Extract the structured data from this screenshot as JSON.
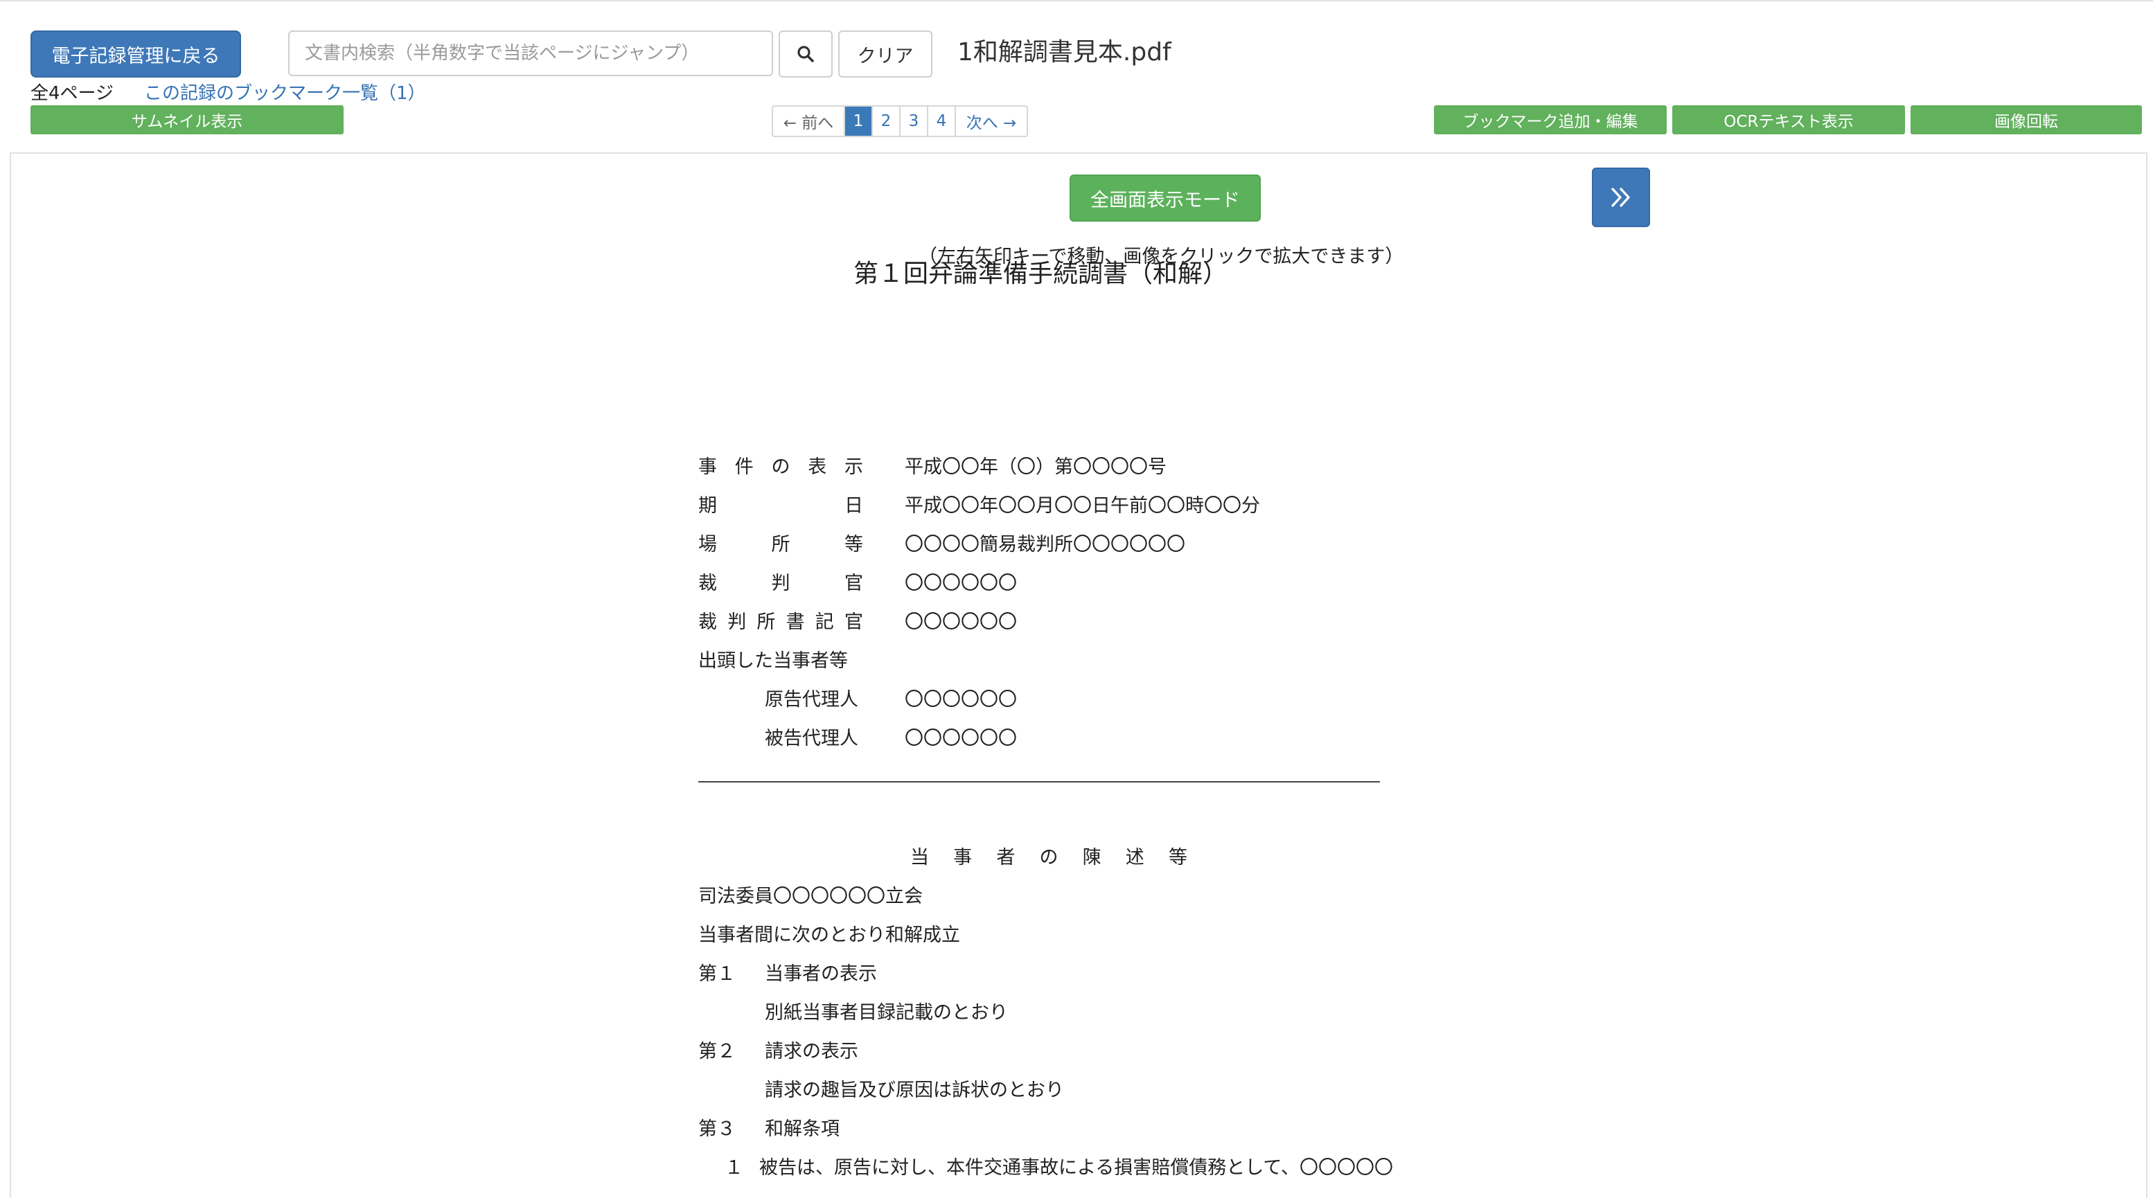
{
  "header": {
    "back_button": "電子記録管理に戻る",
    "search_placeholder": "文書内検索（半角数字で当該ページにジャンプ）",
    "clear_button": "クリア",
    "filename": "1和解調書見本.pdf",
    "page_count": "全4ページ",
    "bookmark_link": "この記録のブックマーク一覧（1）"
  },
  "toolbar": {
    "thumbnail_button": "サムネイル表示",
    "bookmark_edit_button": "ブックマーク追加・編集",
    "ocr_button": "OCRテキスト表示",
    "rotate_button": "画像回転"
  },
  "pagination": {
    "prev": "← 前へ",
    "pages": [
      "1",
      "2",
      "3",
      "4"
    ],
    "current": "1",
    "next": "次へ →"
  },
  "viewer": {
    "fullscreen_button": "全画面表示モード",
    "hint": "（左右矢印キーで移動、画像をクリックで拡大できます）"
  },
  "document": {
    "title": "第１回弁論準備手続調書（和解）",
    "fields": [
      {
        "label_chars": [
          "事",
          "件",
          "の",
          "表",
          "示"
        ],
        "value": "平成〇〇年（〇）第〇〇〇〇号"
      },
      {
        "label_chars": [
          "期",
          "日"
        ],
        "value": "平成〇〇年〇〇月〇〇日午前〇〇時〇〇分"
      },
      {
        "label_chars": [
          "場",
          "所",
          "等"
        ],
        "value": "〇〇〇〇簡易裁判所〇〇〇〇〇〇"
      },
      {
        "label_chars": [
          "裁",
          "判",
          "官"
        ],
        "value": "〇〇〇〇〇〇"
      },
      {
        "label_chars": [
          "裁",
          "判",
          "所",
          "書",
          "記",
          "官"
        ],
        "value": "〇〇〇〇〇〇"
      }
    ],
    "parties_heading": "出頭した当事者等",
    "parties": [
      {
        "label": "原告代理人",
        "value": "〇〇〇〇〇〇"
      },
      {
        "label": "被告代理人",
        "value": "〇〇〇〇〇〇"
      }
    ],
    "section_heading_chars": [
      "当",
      "事",
      "者",
      "の",
      "陳",
      "述",
      "等"
    ],
    "body_lines": [
      "司法委員〇〇〇〇〇〇立会",
      "当事者間に次のとおり和解成立"
    ],
    "item1_num": "第１",
    "item1_title": "当事者の表示",
    "item1_body": "別紙当事者目録記載のとおり",
    "item2_num": "第２",
    "item2_title": "請求の表示",
    "item2_body": "請求の趣旨及び原因は訴状のとおり",
    "item3_num": "第３",
    "item3_title": "和解条項",
    "clause1_num": "１",
    "clause1_text": "被告は、原告に対し、本件交通事故による損害賠償債務として、〇〇〇〇〇"
  },
  "colors": {
    "primary_blue": "#3e78b8",
    "success_green": "#5cb25c",
    "link_blue": "#3572b3"
  },
  "icons": {
    "search": "search-icon",
    "next_page": "double-chevron-right-icon"
  }
}
